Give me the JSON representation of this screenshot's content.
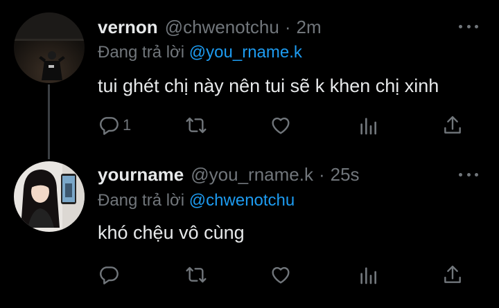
{
  "replying_label": "Đang trả lời",
  "tweets": [
    {
      "display_name": "vernon",
      "handle": "@chwenotchu",
      "time": "2m",
      "replying_to": "@you_rname.k",
      "text": "tui ghét chị này nên tui sẽ k khen chị xinh",
      "reply_count": "1"
    },
    {
      "display_name": "yourname",
      "handle": "@you_rname.k",
      "time": "25s",
      "replying_to": "@chwenotchu",
      "text": "khó chệu vô cùng",
      "reply_count": ""
    }
  ],
  "separator": "·",
  "colors": {
    "background": "#000000",
    "text": "#e7e9ea",
    "muted": "#71767b",
    "accent": "#1d9bf0",
    "thread_line": "#3b3f43"
  },
  "icons": [
    "reply-icon",
    "retweet-icon",
    "like-icon",
    "views-icon",
    "share-icon",
    "more-icon"
  ]
}
